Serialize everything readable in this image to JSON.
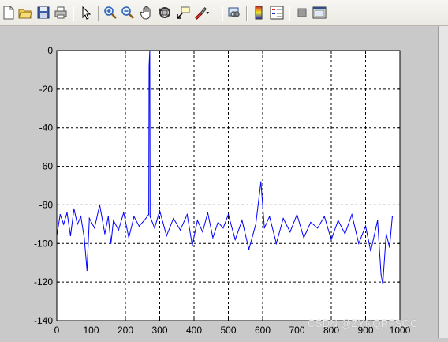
{
  "toolbar": {
    "buttons": [
      {
        "name": "new-figure-icon"
      },
      {
        "name": "open-file-icon"
      },
      {
        "name": "save-icon"
      },
      {
        "name": "print-icon"
      },
      {
        "name": "edit-plot-arrow-icon"
      },
      {
        "name": "zoom-in-icon"
      },
      {
        "name": "zoom-out-icon"
      },
      {
        "name": "pan-hand-icon"
      },
      {
        "name": "rotate-3d-icon"
      },
      {
        "name": "data-cursor-icon"
      },
      {
        "name": "brush-icon"
      },
      {
        "name": "link-plot-icon"
      },
      {
        "name": "colorbar-icon"
      },
      {
        "name": "legend-icon"
      },
      {
        "name": "hide-plot-tools-icon"
      },
      {
        "name": "show-plot-tools-icon"
      }
    ]
  },
  "watermark": "CSDN @ZYNQRFSOC",
  "chart_data": {
    "type": "line",
    "title": "",
    "xlabel": "",
    "ylabel": "",
    "xlim": [
      0,
      1000
    ],
    "ylim": [
      -140,
      0
    ],
    "xticks": [
      0,
      100,
      200,
      300,
      400,
      500,
      600,
      700,
      800,
      900,
      1000
    ],
    "yticks": [
      0,
      -20,
      -40,
      -60,
      -80,
      -100,
      -120,
      -140
    ],
    "grid": true,
    "line_color": "#0000ff",
    "series": [
      {
        "points": [
          [
            1,
            -95
          ],
          [
            10,
            -85
          ],
          [
            20,
            -90
          ],
          [
            30,
            -84
          ],
          [
            40,
            -96
          ],
          [
            50,
            -82
          ],
          [
            60,
            -90
          ],
          [
            70,
            -86
          ],
          [
            80,
            -97
          ],
          [
            88,
            -114
          ],
          [
            95,
            -87
          ],
          [
            110,
            -92
          ],
          [
            125,
            -80
          ],
          [
            140,
            -95
          ],
          [
            150,
            -86
          ],
          [
            158,
            -100
          ],
          [
            165,
            -88
          ],
          [
            180,
            -93
          ],
          [
            195,
            -84
          ],
          [
            210,
            -97
          ],
          [
            225,
            -86
          ],
          [
            240,
            -91
          ],
          [
            255,
            -88
          ],
          [
            268,
            -85
          ],
          [
            269,
            -8
          ],
          [
            271,
            0
          ],
          [
            272,
            -86
          ],
          [
            285,
            -92
          ],
          [
            300,
            -83
          ],
          [
            320,
            -96
          ],
          [
            340,
            -87
          ],
          [
            360,
            -93
          ],
          [
            380,
            -85
          ],
          [
            395,
            -101
          ],
          [
            410,
            -88
          ],
          [
            425,
            -94
          ],
          [
            440,
            -84
          ],
          [
            455,
            -97
          ],
          [
            470,
            -89
          ],
          [
            485,
            -92
          ],
          [
            500,
            -85
          ],
          [
            520,
            -98
          ],
          [
            540,
            -88
          ],
          [
            560,
            -103
          ],
          [
            580,
            -90
          ],
          [
            595,
            -68
          ],
          [
            605,
            -92
          ],
          [
            620,
            -86
          ],
          [
            640,
            -100
          ],
          [
            660,
            -87
          ],
          [
            680,
            -94
          ],
          [
            700,
            -85
          ],
          [
            720,
            -97
          ],
          [
            740,
            -89
          ],
          [
            760,
            -92
          ],
          [
            780,
            -86
          ],
          [
            800,
            -98
          ],
          [
            820,
            -88
          ],
          [
            840,
            -95
          ],
          [
            860,
            -85
          ],
          [
            880,
            -100
          ],
          [
            900,
            -91
          ],
          [
            915,
            -104
          ],
          [
            925,
            -96
          ],
          [
            935,
            -88
          ],
          [
            945,
            -116
          ],
          [
            950,
            -121
          ],
          [
            960,
            -95
          ],
          [
            970,
            -102
          ],
          [
            978,
            -86
          ]
        ]
      }
    ]
  }
}
